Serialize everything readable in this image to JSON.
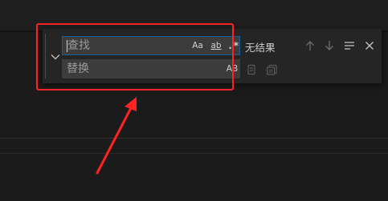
{
  "find_widget": {
    "find_placeholder": "查找",
    "replace_placeholder": "替换",
    "options": {
      "match_case": "Aa",
      "whole_word": "ab",
      "regex": ".*",
      "preserve_case": "AB"
    },
    "result_text": "无结果"
  },
  "icons": {
    "toggle": "chevron-down-icon",
    "prev": "arrow-up-icon",
    "next": "arrow-down-icon",
    "selection": "find-in-selection-icon",
    "close": "close-icon",
    "replace_one": "replace-icon",
    "replace_all": "replace-all-icon"
  },
  "colors": {
    "annotation": "#ff2222",
    "focus_border": "#0e639c",
    "widget_bg": "#252526",
    "input_bg": "#3c3c3c"
  }
}
